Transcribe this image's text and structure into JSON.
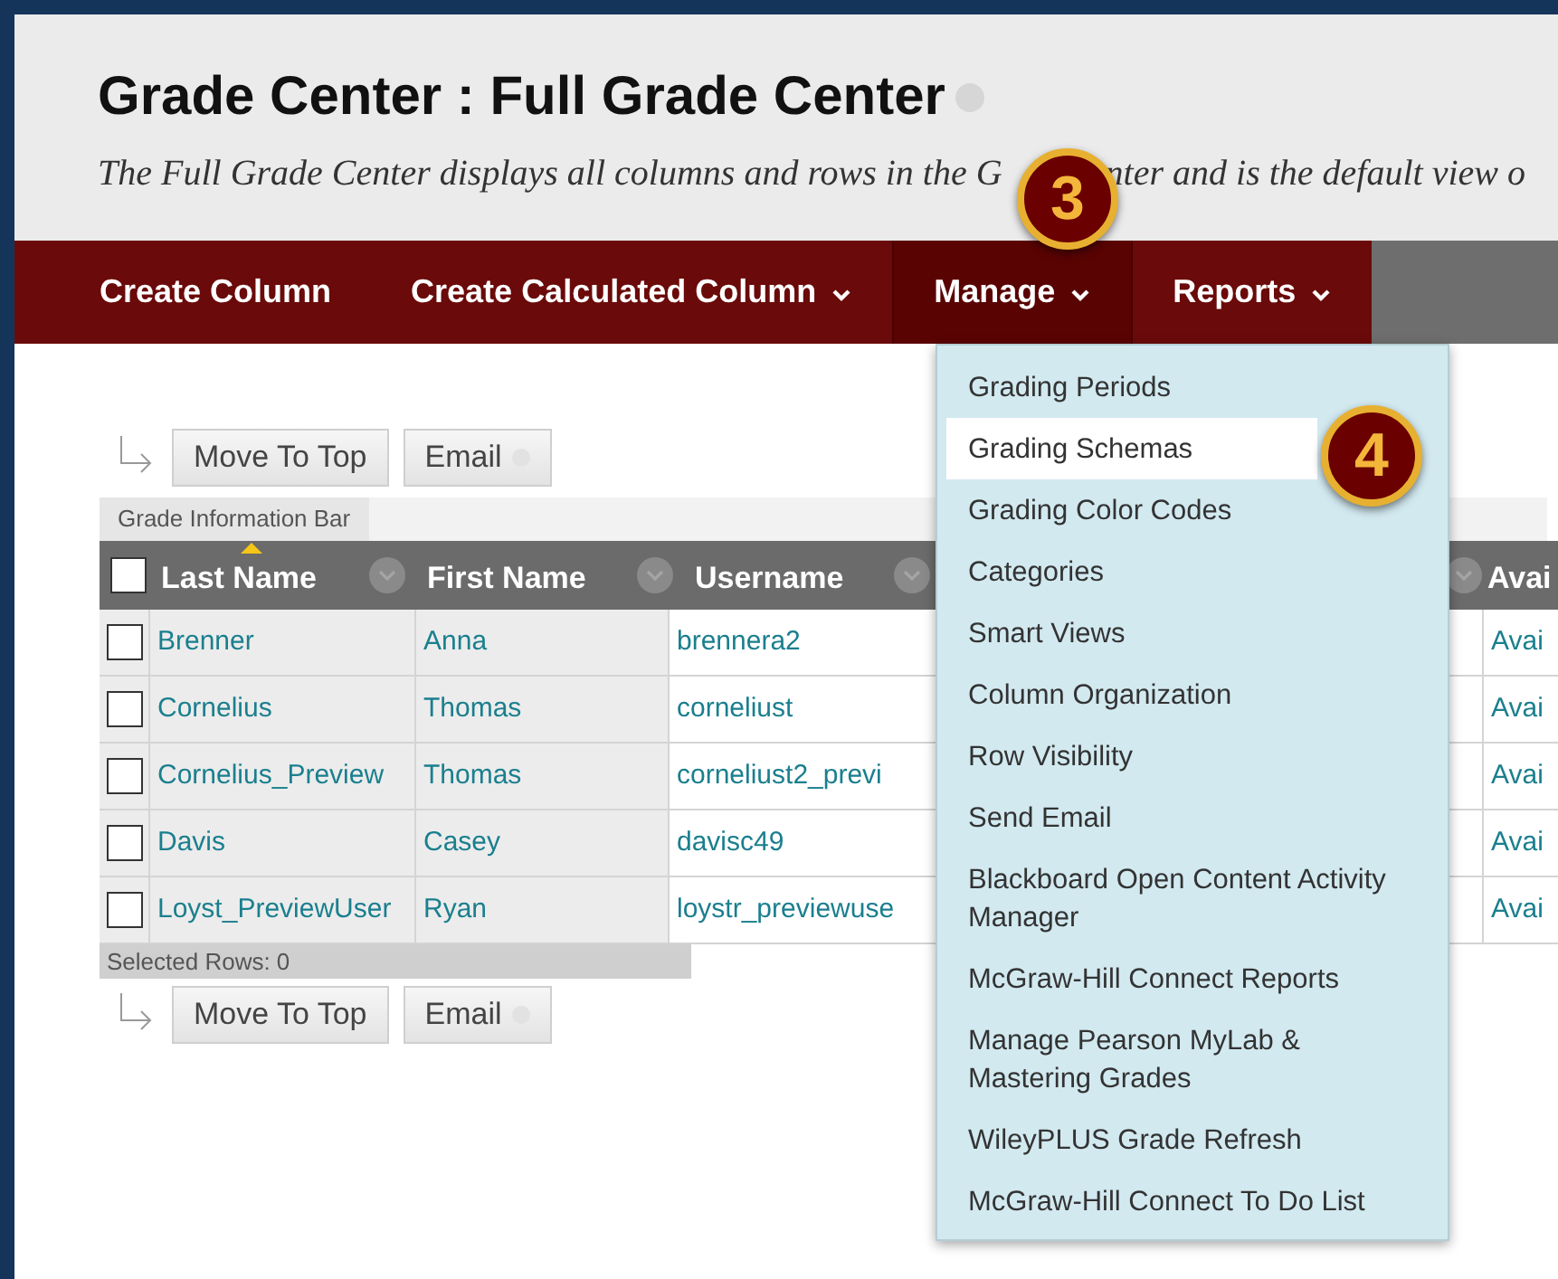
{
  "header": {
    "title": "Grade Center : Full Grade Center",
    "description_before": "The Full Grade Center displays all columns and rows in the G",
    "description_after": "nter and is the default view o"
  },
  "nav": [
    {
      "label": "Create Column",
      "has_menu": false,
      "selected": false
    },
    {
      "label": "Create Calculated Column",
      "has_menu": true,
      "selected": false
    },
    {
      "label": "Manage",
      "has_menu": true,
      "selected": true
    },
    {
      "label": "Reports",
      "has_menu": true,
      "selected": false
    }
  ],
  "toolbar_top": [
    "Move To Top",
    "Email"
  ],
  "info_bar": "Grade Information Bar",
  "table": {
    "all_selected": false,
    "columns": [
      {
        "label": "Last Name",
        "sorted": true
      },
      {
        "label": "First Name",
        "sorted": false
      },
      {
        "label": "Username",
        "sorted": false
      },
      {
        "label": "Avai",
        "sorted": false
      }
    ],
    "rows": [
      {
        "checked": false,
        "cells": [
          "Brenner",
          "Anna",
          "brennera2",
          "Avai"
        ]
      },
      {
        "checked": false,
        "cells": [
          "Cornelius",
          "Thomas",
          "corneliust",
          "Avai"
        ]
      },
      {
        "checked": false,
        "cells": [
          "Cornelius_Preview",
          "Thomas",
          "corneliust2_previ",
          "Avai"
        ]
      },
      {
        "checked": false,
        "cells": [
          "Davis",
          "Casey",
          "davisc49",
          "Avai"
        ]
      },
      {
        "checked": false,
        "cells": [
          "Loyst_PreviewUser",
          "Ryan",
          "loystr_previewuse",
          "Avai"
        ]
      }
    ]
  },
  "selected_rows": "Selected Rows: 0",
  "toolbar_bottom": [
    "Move To Top",
    "Email"
  ],
  "manage_menu": [
    {
      "label": "Grading Periods",
      "selected": false
    },
    {
      "label": "Grading Schemas",
      "selected": true
    },
    {
      "label": "Grading Color Codes",
      "selected": false
    },
    {
      "label": "Categories",
      "selected": false
    },
    {
      "label": "Smart Views",
      "selected": false
    },
    {
      "label": "Column Organization",
      "selected": false
    },
    {
      "label": "Row Visibility",
      "selected": false
    },
    {
      "label": "Send Email",
      "selected": false
    },
    {
      "label": "Blackboard Open Content Activity Manager",
      "selected": false
    },
    {
      "label": "McGraw-Hill Connect Reports",
      "selected": false
    },
    {
      "label": "Manage Pearson MyLab & Mastering Grades",
      "selected": false
    },
    {
      "label": "WileyPLUS Grade Refresh",
      "selected": false
    },
    {
      "label": "McGraw-Hill Connect To Do List",
      "selected": false
    }
  ],
  "step_badges": [
    "3",
    "4"
  ]
}
